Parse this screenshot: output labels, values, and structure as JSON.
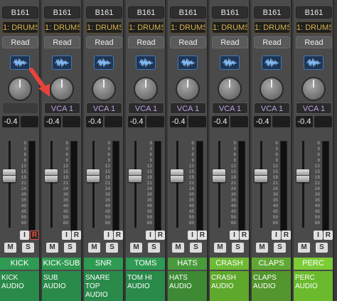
{
  "colors": {
    "name_green_dark": "#2b8a4b",
    "name_green_light": "#79c83a",
    "vca_text": "#b9a3e6",
    "drums_text": "#d8b24a",
    "record_red": "#e84b3c",
    "arrow_red": "#e8433b"
  },
  "scale_labels": [
    "0",
    "3",
    "6",
    "9",
    "12",
    "15",
    "18",
    "21",
    "24",
    "30",
    "35",
    "40",
    "45",
    "50",
    "60"
  ],
  "channels": [
    {
      "output": "B161",
      "group": "1: DRUMS",
      "automation": "Read",
      "vca": "",
      "gain": "-0.4",
      "fader": 0.62,
      "input": "I",
      "record": "R",
      "record_armed": true,
      "mute": "M",
      "solo": "S",
      "name": "KICK",
      "track": "KICK AUDIO",
      "name_bg": "#2f9a52",
      "track_bg": "#2a8a4a"
    },
    {
      "output": "B161",
      "group": "1: DRUMS",
      "automation": "Read",
      "vca": "VCA 1",
      "gain": "-0.4",
      "fader": 0.62,
      "input": "I",
      "record": "R",
      "record_armed": false,
      "mute": "M",
      "solo": "S",
      "name": "KICK-SUB",
      "track": "SUB AUDIO",
      "name_bg": "#2f9a52",
      "track_bg": "#2a8a4a"
    },
    {
      "output": "B161",
      "group": "1: DRUMS",
      "automation": "Read",
      "vca": "VCA 1",
      "gain": "-0.4",
      "fader": 0.62,
      "input": "I",
      "record": "R",
      "record_armed": false,
      "mute": "M",
      "solo": "S",
      "name": "SNR",
      "track": "SNARE TOP AUDIO",
      "name_bg": "#2f9a52",
      "track_bg": "#2a8a4a"
    },
    {
      "output": "B161",
      "group": "1: DRUMS",
      "automation": "Read",
      "vca": "VCA 1",
      "gain": "-0.4",
      "fader": 0.62,
      "input": "I",
      "record": "R",
      "record_armed": false,
      "mute": "M",
      "solo": "S",
      "name": "TOMS",
      "track": "TOM HI AUDIO",
      "name_bg": "#2f9a52",
      "track_bg": "#2a8a4a"
    },
    {
      "output": "B161",
      "group": "1: DRUMS",
      "automation": "Read",
      "vca": "VCA 1",
      "gain": "-0.4",
      "fader": 0.62,
      "input": "I",
      "record": "R",
      "record_armed": false,
      "mute": "M",
      "solo": "S",
      "name": "HATS",
      "track": "HATS AUDIO",
      "name_bg": "#4a9a3c",
      "track_bg": "#3e8a34"
    },
    {
      "output": "B161",
      "group": "1: DRUMS",
      "automation": "Read",
      "vca": "VCA 1",
      "gain": "-0.4",
      "fader": 0.62,
      "input": "I",
      "record": "R",
      "record_armed": false,
      "mute": "M",
      "solo": "S",
      "name": "CRASH",
      "track": "CRASH AUDIO",
      "name_bg": "#6dbb34",
      "track_bg": "#5ea82c"
    },
    {
      "output": "B161",
      "group": "1: DRUMS",
      "automation": "Read",
      "vca": "VCA 1",
      "gain": "-0.4",
      "fader": 0.62,
      "input": "I",
      "record": "R",
      "record_armed": false,
      "mute": "M",
      "solo": "S",
      "name": "CLAPS",
      "track": "CLAPS AUDIO",
      "name_bg": "#5fa833",
      "track_bg": "#53962d"
    },
    {
      "output": "B161",
      "group": "1: DRUMS",
      "automation": "Read",
      "vca": "VCA 1",
      "gain": "-0.4",
      "fader": 0.62,
      "input": "I",
      "record": "R",
      "record_armed": false,
      "mute": "M",
      "solo": "S",
      "name": "PERC",
      "track": "PERC AUDIO",
      "name_bg": "#7ccc36",
      "track_bg": "#6bba2e"
    }
  ]
}
